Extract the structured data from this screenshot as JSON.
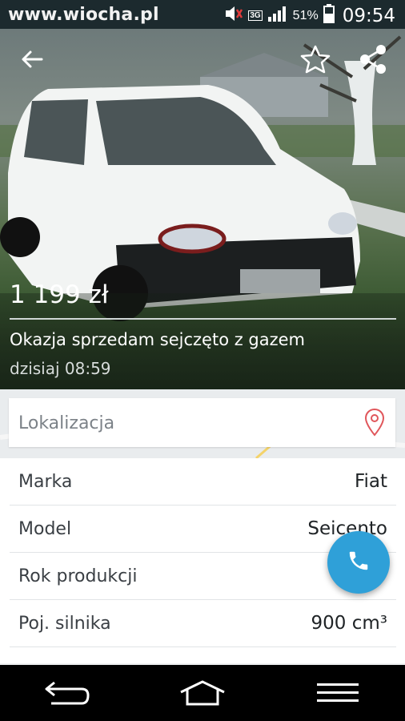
{
  "status_bar": {
    "watermark": "www.wiocha.pl",
    "network": "3G",
    "battery": "51%",
    "time": "09:54"
  },
  "icons": {
    "back": "back-arrow-icon",
    "favorite": "star-outline-icon",
    "share": "share-icon",
    "location": "map-pin-icon",
    "call": "phone-icon",
    "nav_back": "nav-back-icon",
    "nav_home": "nav-home-icon",
    "nav_menu": "nav-menu-icon"
  },
  "listing": {
    "price": "1 199 zł",
    "title": "Okazja sprzedam sejczęto z gazem",
    "date": "dzisiaj 08:59"
  },
  "location": {
    "label": "Lokalizacja"
  },
  "details": [
    {
      "key": "Marka",
      "value": "Fiat"
    },
    {
      "key": "Model",
      "value": "Seicento"
    },
    {
      "key": "Rok produkcji",
      "value": ""
    },
    {
      "key": "Poj. silnika",
      "value": "900 cm³"
    }
  ],
  "colors": {
    "accent": "#2fa0d8",
    "pin": "#e0565b"
  }
}
